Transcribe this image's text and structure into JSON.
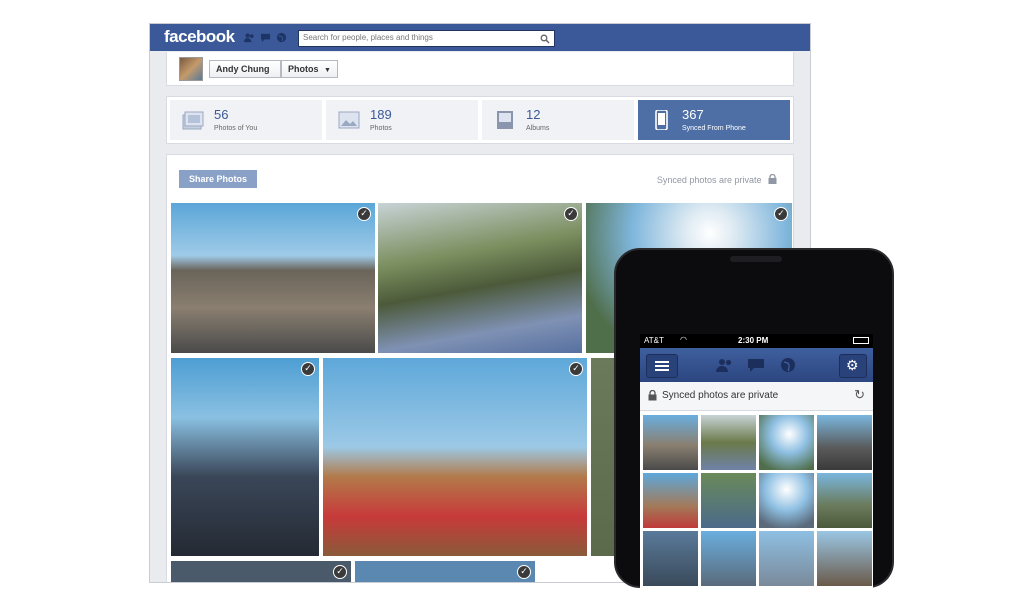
{
  "topbar": {
    "logo": "facebook",
    "search_placeholder": "Search for people, places and things"
  },
  "profile": {
    "name": "Andy Chung",
    "section": "Photos"
  },
  "stats": [
    {
      "count": "56",
      "label": "Photos of You",
      "icon": "photo-stack-icon"
    },
    {
      "count": "189",
      "label": "Photos",
      "icon": "photo-icon"
    },
    {
      "count": "12",
      "label": "Albums",
      "icon": "album-icon"
    },
    {
      "count": "367",
      "label": "Synced From Phone",
      "icon": "phone-icon"
    }
  ],
  "content": {
    "share_button": "Share Photos",
    "private_note": "Synced photos are private"
  },
  "phone": {
    "carrier": "AT&T",
    "time": "2:30 PM",
    "synced_label": "Synced photos are private"
  },
  "colors": {
    "brand": "#3b5998",
    "active_tab": "#4e6fa5",
    "share_button": "#8aa1c7"
  }
}
